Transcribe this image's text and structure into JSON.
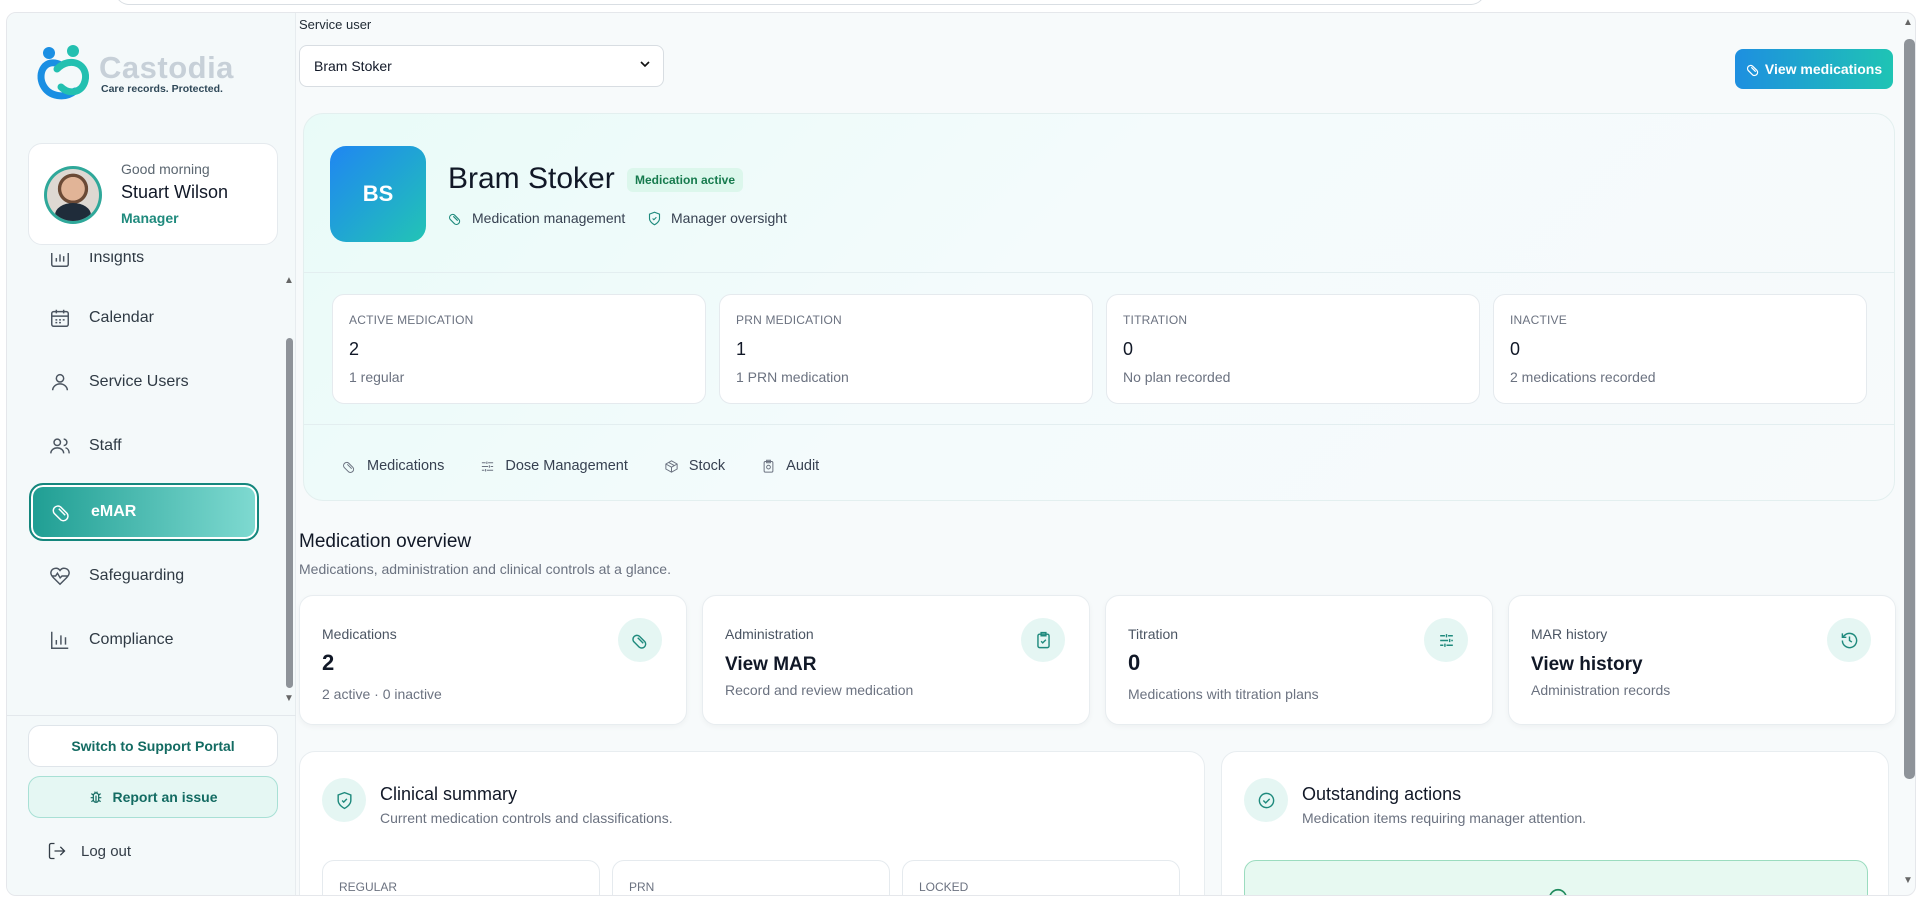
{
  "brand": {
    "name": "Castodia",
    "tagline": "Care records. Protected."
  },
  "user": {
    "greeting": "Good morning",
    "name": "Stuart Wilson",
    "role": "Manager"
  },
  "nav": {
    "items": [
      {
        "label": "Insights"
      },
      {
        "label": "Calendar"
      },
      {
        "label": "Service Users"
      },
      {
        "label": "Staff"
      },
      {
        "label": "eMAR"
      },
      {
        "label": "Safeguarding"
      },
      {
        "label": "Compliance"
      }
    ],
    "active": "eMAR"
  },
  "sidebar_actions": {
    "support": "Switch to Support Portal",
    "report": "Report an issue",
    "logout": "Log out"
  },
  "service_user": {
    "label": "Service user",
    "selected": "Bram Stoker"
  },
  "view_medications": "View medications",
  "profile": {
    "initials": "BS",
    "name": "Bram Stoker",
    "badge": "Medication active",
    "meta": [
      "Medication management",
      "Manager oversight"
    ]
  },
  "stats": [
    {
      "label": "ACTIVE MEDICATION",
      "value": "2",
      "sub": "1 regular"
    },
    {
      "label": "PRN MEDICATION",
      "value": "1",
      "sub": "1 PRN medication"
    },
    {
      "label": "TITRATION",
      "value": "0",
      "sub": "No plan recorded"
    },
    {
      "label": "INACTIVE",
      "value": "0",
      "sub": "2 medications recorded"
    }
  ],
  "tabs": [
    "Medications",
    "Dose Management",
    "Stock",
    "Audit"
  ],
  "overview": {
    "title": "Medication overview",
    "subtitle": "Medications, administration and clinical controls at a glance.",
    "cards": [
      {
        "label": "Medications",
        "value": "2",
        "sub": "2 active · 0 inactive"
      },
      {
        "label": "Administration",
        "value": "View MAR",
        "sub": "Record and review medication"
      },
      {
        "label": "Titration",
        "value": "0",
        "sub": "Medications with titration plans"
      },
      {
        "label": "MAR history",
        "value": "View history",
        "sub": "Administration records"
      }
    ]
  },
  "clinical_summary": {
    "title": "Clinical summary",
    "subtitle": "Current medication controls and classifications.",
    "boxes": [
      "REGULAR",
      "PRN",
      "LOCKED"
    ]
  },
  "outstanding": {
    "title": "Outstanding actions",
    "subtitle": "Medication items requiring manager attention."
  },
  "colors": {
    "accent": "#1f9e93",
    "primary_button": "#1e8fe0",
    "badge_bg": "#dcf7ec"
  }
}
